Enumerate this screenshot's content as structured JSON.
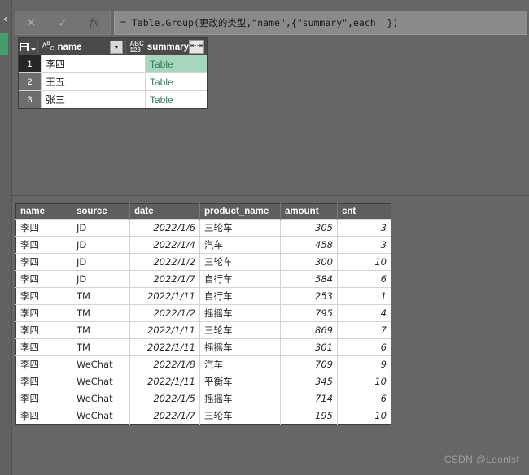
{
  "colors": {
    "app_background": "#666666",
    "accent_green": "#469c6e",
    "selection_green": "#a6d6bd",
    "header_dark": "#4a4a4a",
    "link_green": "#2f7a5a"
  },
  "left_rail": {
    "collapse_icon": "chevron-left-icon",
    "collapse_glyph": "‹",
    "active_query_marker": ""
  },
  "formula_bar": {
    "cancel_glyph": "✕",
    "confirm_glyph": "✓",
    "fx_label": "fx",
    "formula": "= Table.Group(更改的类型,\"name\",{\"summary\",each _})"
  },
  "group_grid": {
    "selector_icon": "table-grid-icon",
    "columns": [
      {
        "label": "name",
        "type_icon": "abc-text-type-icon",
        "has_filter": true
      },
      {
        "label": "summary",
        "type_icon": "abc123-any-type-icon",
        "has_expand": true
      }
    ],
    "expand_glyph": "⇤⇥",
    "rows": [
      {
        "num": "1",
        "name": "李四",
        "summary": "Table",
        "selected": true
      },
      {
        "num": "2",
        "name": "王五",
        "summary": "Table",
        "selected": false
      },
      {
        "num": "3",
        "name": "张三",
        "summary": "Table",
        "selected": false
      }
    ]
  },
  "preview_table": {
    "headers": [
      "name",
      "source",
      "date",
      "product_name",
      "amount",
      "cnt"
    ],
    "rows": [
      [
        "李四",
        "JD",
        "2022/1/6",
        "三轮车",
        "305",
        "3"
      ],
      [
        "李四",
        "JD",
        "2022/1/4",
        "汽车",
        "458",
        "3"
      ],
      [
        "李四",
        "JD",
        "2022/1/2",
        "三轮车",
        "300",
        "10"
      ],
      [
        "李四",
        "JD",
        "2022/1/7",
        "自行车",
        "584",
        "6"
      ],
      [
        "李四",
        "TM",
        "2022/1/11",
        "自行车",
        "253",
        "1"
      ],
      [
        "李四",
        "TM",
        "2022/1/2",
        "摇摇车",
        "795",
        "4"
      ],
      [
        "李四",
        "TM",
        "2022/1/11",
        "三轮车",
        "869",
        "7"
      ],
      [
        "李四",
        "TM",
        "2022/1/11",
        "摇摇车",
        "301",
        "6"
      ],
      [
        "李四",
        "WeChat",
        "2022/1/8",
        "汽车",
        "709",
        "9"
      ],
      [
        "李四",
        "WeChat",
        "2022/1/11",
        "平衡车",
        "345",
        "10"
      ],
      [
        "李四",
        "WeChat",
        "2022/1/5",
        "摇摇车",
        "714",
        "6"
      ],
      [
        "李四",
        "WeChat",
        "2022/1/7",
        "三轮车",
        "195",
        "10"
      ]
    ]
  },
  "watermark": {
    "text": "CSDN @Leonlsf"
  }
}
